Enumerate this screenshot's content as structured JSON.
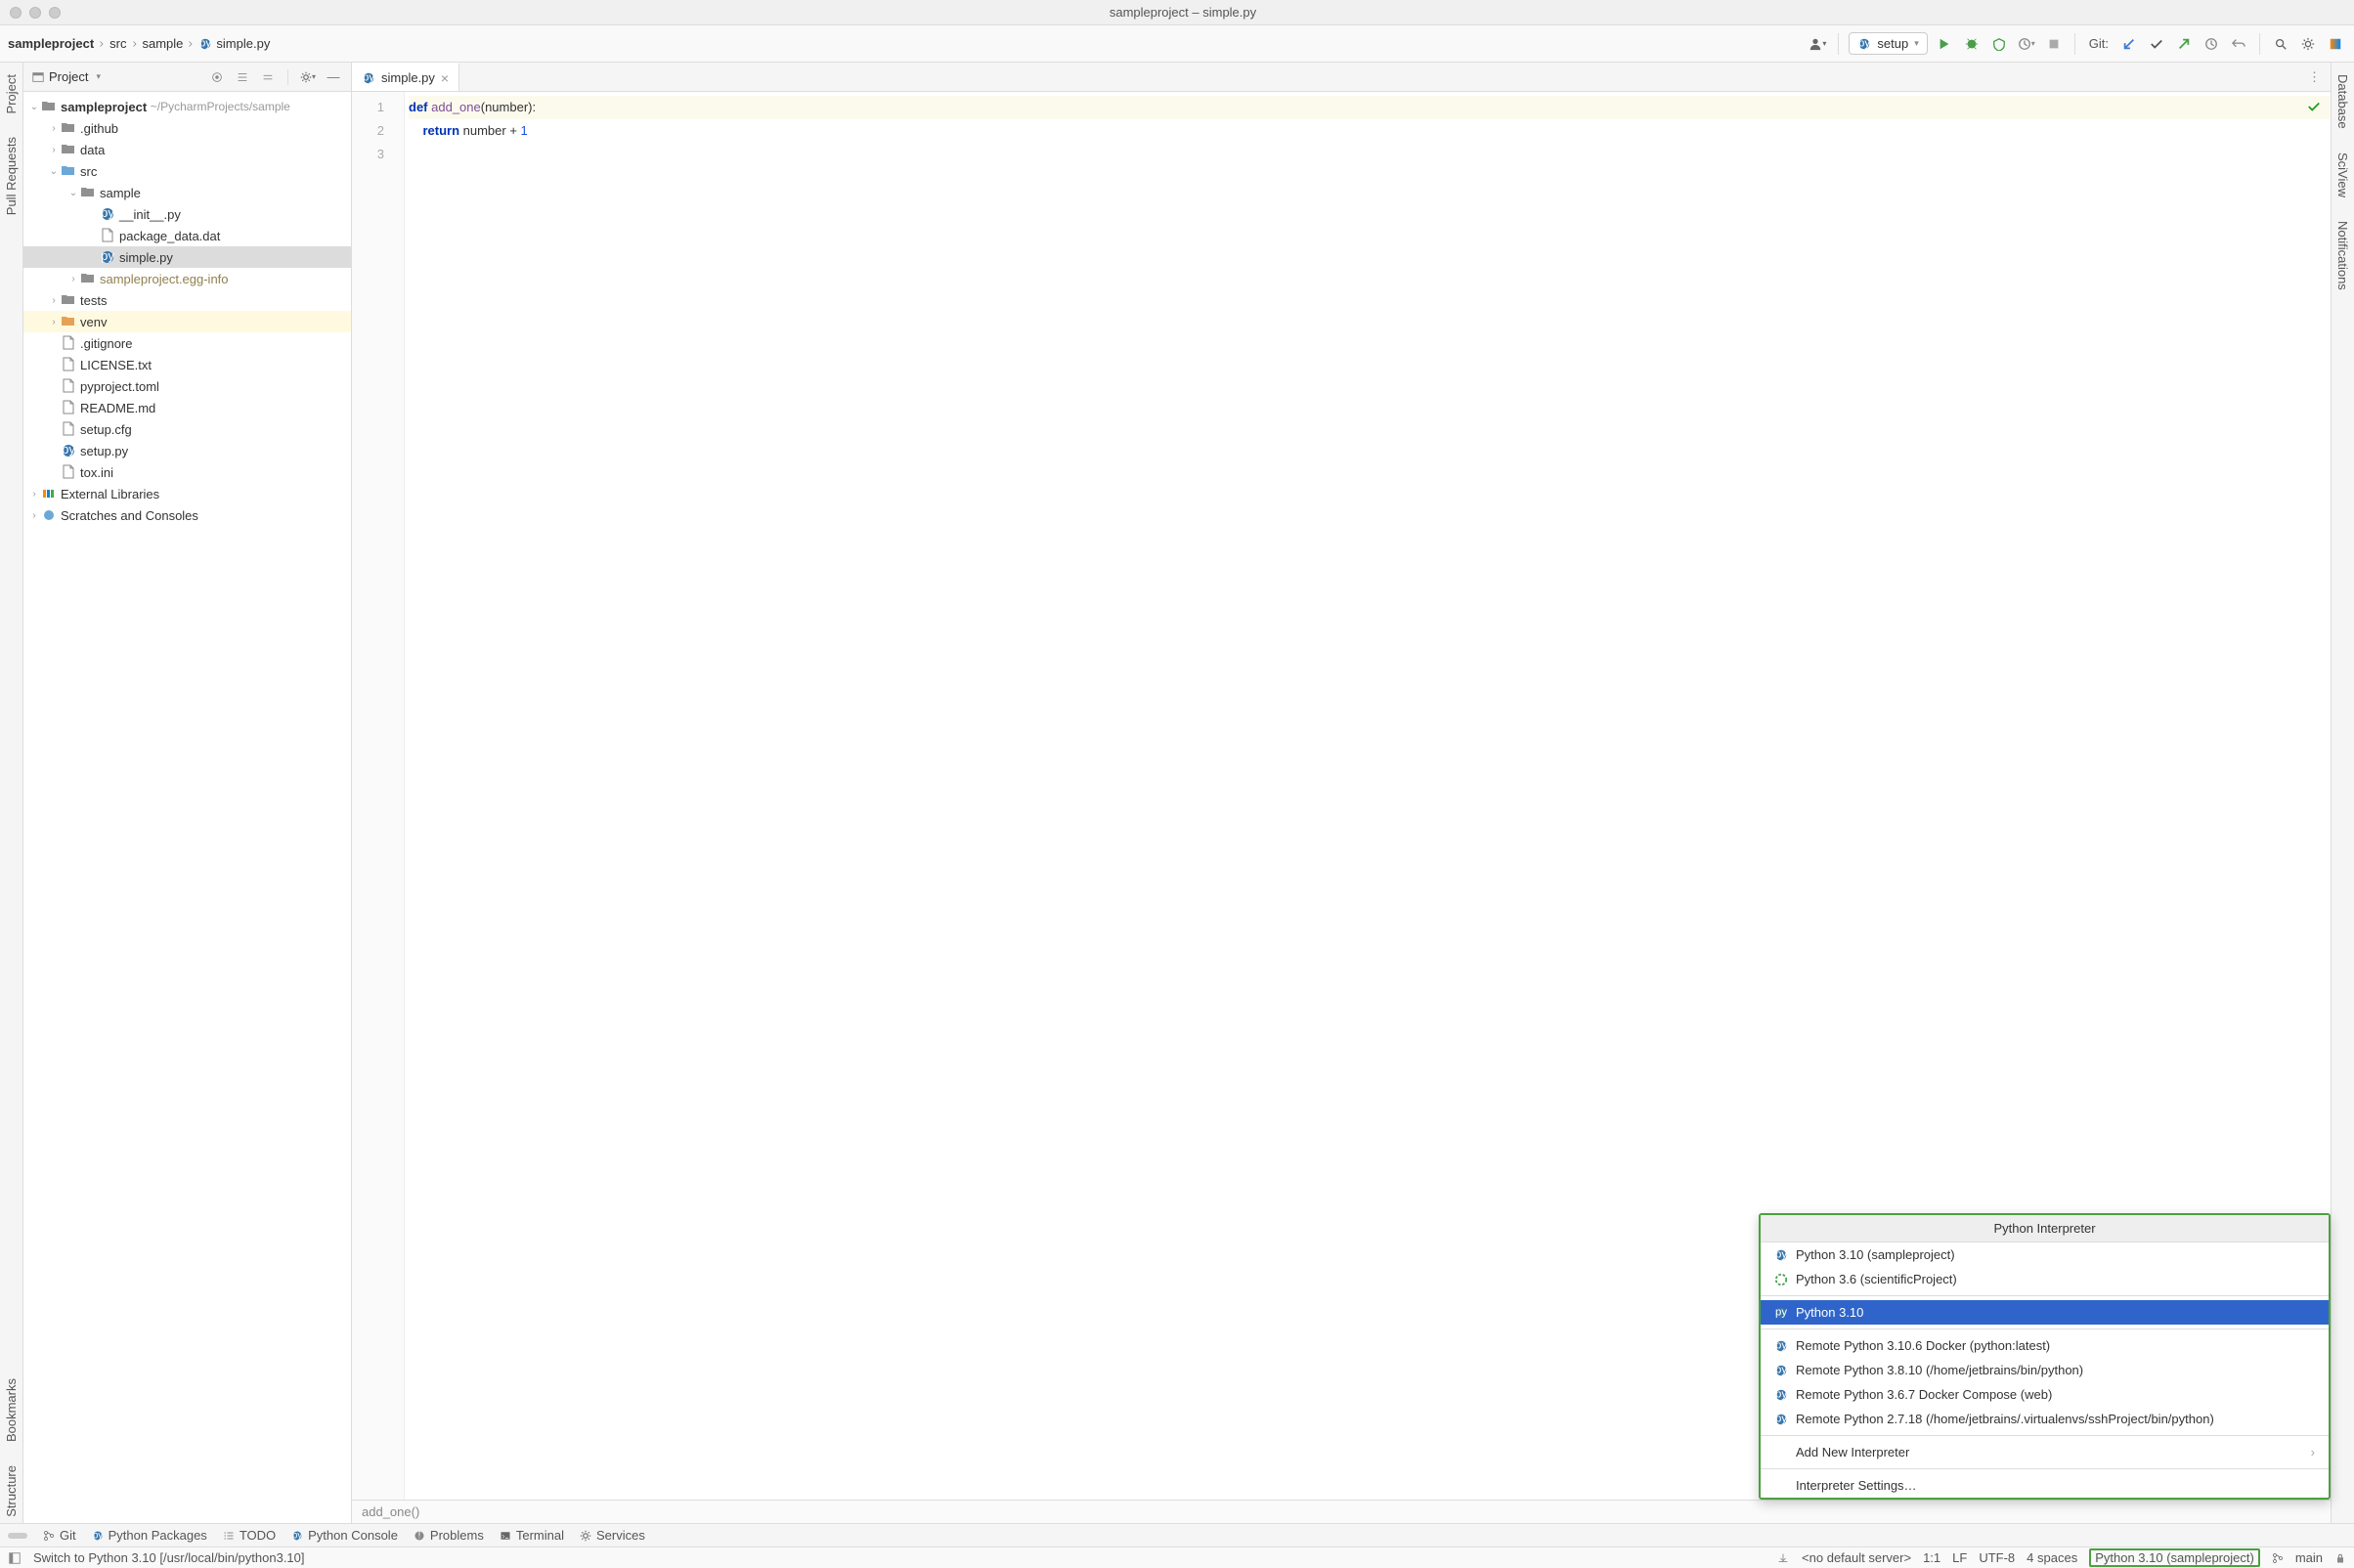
{
  "window_title": "sampleproject – simple.py",
  "breadcrumb": [
    "sampleproject",
    "src",
    "sample",
    "simple.py"
  ],
  "run_config": "setup",
  "git_label": "Git:",
  "project_panel": {
    "title": "Project",
    "root": {
      "name": "sampleproject",
      "path": "~/PycharmProjects/sample"
    },
    "github": ".github",
    "data": "data",
    "src": "src",
    "sample": "sample",
    "init": "__init__.py",
    "package_data": "package_data.dat",
    "simple": "simple.py",
    "egg": "sampleproject.egg-info",
    "tests": "tests",
    "venv": "venv",
    "gitignore": ".gitignore",
    "license": "LICENSE.txt",
    "pyproject": "pyproject.toml",
    "readme": "README.md",
    "setupcfg": "setup.cfg",
    "setuppy": "setup.py",
    "tox": "tox.ini",
    "external": "External Libraries",
    "scratches": "Scratches and Consoles"
  },
  "editor": {
    "tab": "simple.py",
    "lines": [
      "1",
      "2",
      "3"
    ],
    "line1": {
      "def": "def ",
      "fn": "add_one",
      "rest": "(number):"
    },
    "line2": {
      "ret": "    return ",
      "mid": "number + ",
      "num": "1"
    },
    "breadcrumb": "add_one()"
  },
  "popup": {
    "title": "Python Interpreter",
    "items": [
      "Python 3.10 (sampleproject)",
      "Python 3.6 (scientificProject)",
      "Python 3.10",
      "Remote Python 3.10.6 Docker (python:latest)",
      "Remote Python 3.8.10 (/home/jetbrains/bin/python)",
      "Remote Python 3.6.7 Docker Compose (web)",
      "Remote Python 2.7.18 (/home/jetbrains/.virtualenvs/sshProject/bin/python)"
    ],
    "add": "Add New Interpreter",
    "settings": "Interpreter Settings…"
  },
  "side_rails": {
    "left": [
      "Project",
      "Pull Requests",
      "Bookmarks",
      "Structure"
    ],
    "right": [
      "Database",
      "SciView",
      "Notifications"
    ]
  },
  "bottom_tools": [
    "Git",
    "Python Packages",
    "TODO",
    "Python Console",
    "Problems",
    "Terminal",
    "Services"
  ],
  "status": {
    "msg": "Switch to Python 3.10 [/usr/local/bin/python3.10]",
    "server": "<no default server>",
    "pos": "1:1",
    "ending": "LF",
    "encoding": "UTF-8",
    "indent": "4 spaces",
    "interp": "Python 3.10 (sampleproject)",
    "branch": "main"
  }
}
